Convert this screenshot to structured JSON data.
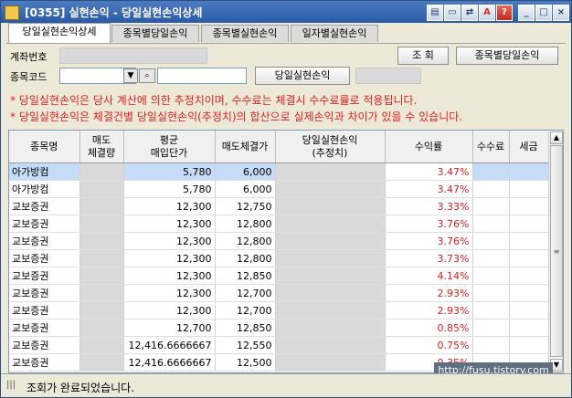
{
  "window": {
    "title": "[0355] 실현손익 - 당일실현손익상세",
    "buttons": [
      "▤",
      "▭",
      "⇄",
      "A",
      "?",
      "_",
      "□",
      "×"
    ]
  },
  "tabs": [
    {
      "label": "당일실현손익상세",
      "active": true
    },
    {
      "label": "종목별당일손익",
      "active": false
    },
    {
      "label": "종목별실현손익",
      "active": false
    },
    {
      "label": "일자별실현손익",
      "active": false
    }
  ],
  "form": {
    "account_label": "계좌번호",
    "stock_code_label": "종목코드",
    "dropdown_arrow": "▼",
    "search_glyph": "⌕",
    "query_button": "조 회",
    "by_stock_button": "종목별당일손익",
    "daily_pnl_label": "당일실현손익"
  },
  "notes": [
    "* 당일실현손익은 당사 계산에 의한 추정치이며, 수수료는 체결시 수수료률로 적용됩니다.",
    "* 당일실현손익은 체결건별 당일실현손익(추정치)의 합산으로 실제손익과 차이가 있을 수 있습니다."
  ],
  "table": {
    "headers": [
      {
        "line1": "종목명",
        "line2": ""
      },
      {
        "line1": "매도",
        "line2": "체결량"
      },
      {
        "line1": "평균",
        "line2": "매입단가"
      },
      {
        "line1": "매도체결가",
        "line2": ""
      },
      {
        "line1": "당일실현손익",
        "line2": "(추정치)"
      },
      {
        "line1": "수익률",
        "line2": ""
      },
      {
        "line1": "수수료",
        "line2": ""
      },
      {
        "line1": "세금",
        "line2": ""
      }
    ],
    "rows": [
      {
        "name": "아가방컴",
        "avg_price": "5,780",
        "sell_price": "6,000",
        "rate": "3.47%",
        "selected": true
      },
      {
        "name": "아가방컴",
        "avg_price": "5,780",
        "sell_price": "6,000",
        "rate": "3.47%"
      },
      {
        "name": "교보증권",
        "avg_price": "12,300",
        "sell_price": "12,750",
        "rate": "3.33%"
      },
      {
        "name": "교보증권",
        "avg_price": "12,300",
        "sell_price": "12,800",
        "rate": "3.76%"
      },
      {
        "name": "교보증권",
        "avg_price": "12,300",
        "sell_price": "12,800",
        "rate": "3.76%"
      },
      {
        "name": "교보증권",
        "avg_price": "12,300",
        "sell_price": "12,800",
        "rate": "3.73%"
      },
      {
        "name": "교보증권",
        "avg_price": "12,300",
        "sell_price": "12,850",
        "rate": "4.14%"
      },
      {
        "name": "교보증권",
        "avg_price": "12,300",
        "sell_price": "12,700",
        "rate": "2.93%"
      },
      {
        "name": "교보증권",
        "avg_price": "12,300",
        "sell_price": "12,700",
        "rate": "2.93%"
      },
      {
        "name": "교보증권",
        "avg_price": "12,700",
        "sell_price": "12,850",
        "rate": "0.85%"
      },
      {
        "name": "교보증권",
        "avg_price": "12,416.6666667",
        "sell_price": "12,550",
        "rate": "0.75%"
      },
      {
        "name": "교보증권",
        "avg_price": "12,416.6666667",
        "sell_price": "12,500",
        "rate": "0.35%"
      }
    ]
  },
  "scrollbar": {
    "up": "▲",
    "down": "▼",
    "grip": "≡"
  },
  "status": {
    "grip": "|||",
    "message": "조회가 완료되었습니다."
  },
  "watermark": "http://fusu.tistory.com",
  "colors": {
    "accent": "#2a5aa6",
    "profit": "#e02020",
    "selected_row": "#c6dcf6"
  }
}
